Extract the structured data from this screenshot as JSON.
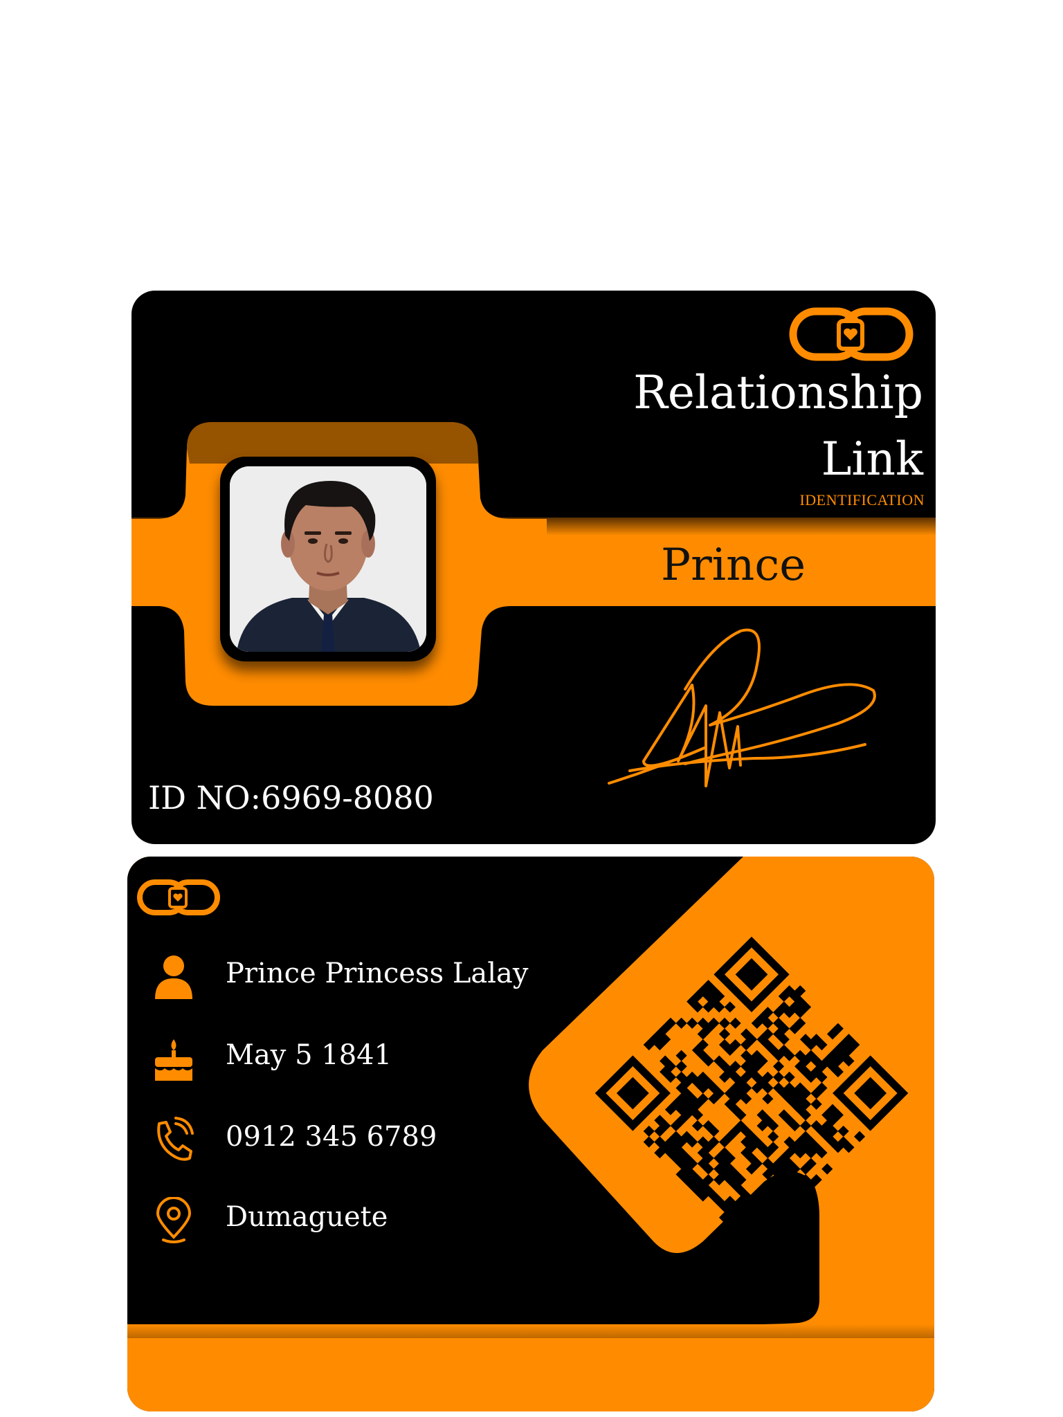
{
  "colors": {
    "accent": "#ff8c00",
    "card": "#000000",
    "text": "#ffffff"
  },
  "front": {
    "logo_icon": "chain-link-heart-icon",
    "title": "Relationship\nLink",
    "subtitle": "IDENTIFICATION",
    "name": "Prince",
    "id_number": "ID NO:6969-8080",
    "photo": "portrait-photo",
    "signature": "handwritten-signature"
  },
  "back": {
    "logo_icon": "chain-link-heart-icon",
    "rows": [
      {
        "icon": "person-icon",
        "text": "Prince Princess Lalay"
      },
      {
        "icon": "birthday-cake-icon",
        "text": "May 5 1841"
      },
      {
        "icon": "phone-icon",
        "text": "0912 345 6789"
      },
      {
        "icon": "location-pin-icon",
        "text": "Dumaguete"
      }
    ],
    "qr_code": "qr-code"
  }
}
